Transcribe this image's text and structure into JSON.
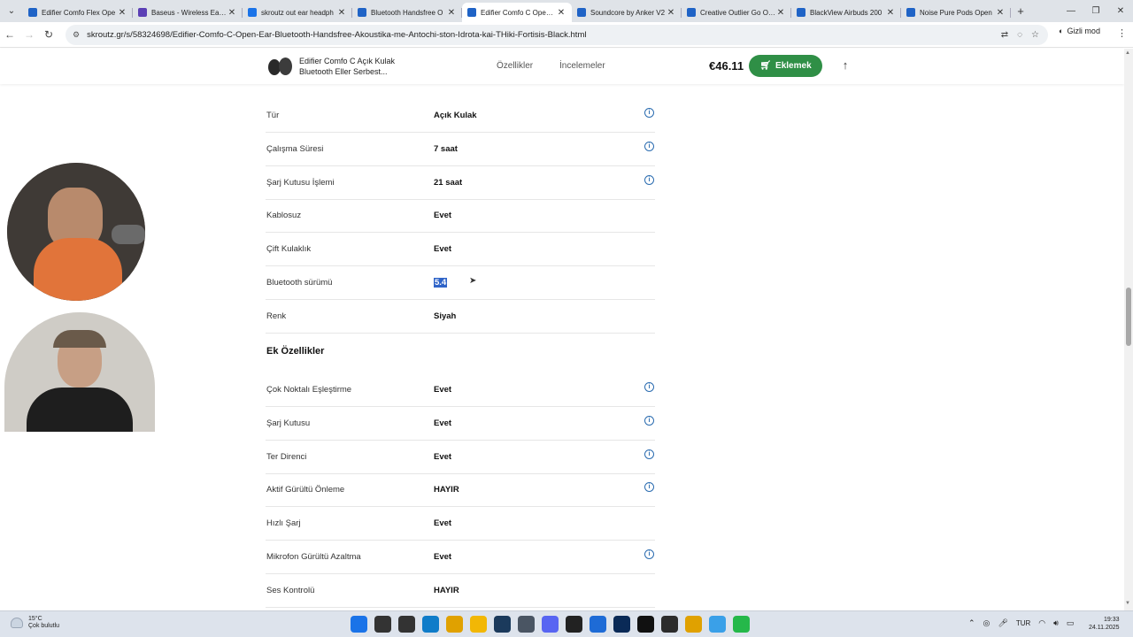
{
  "browser": {
    "tabs": [
      {
        "title": "Edifier Comfo Flex Ope",
        "color": "#1f63c6",
        "active": false
      },
      {
        "title": "Baseus - Wireless Earbu",
        "color": "#5b3fb5",
        "active": false
      },
      {
        "title": "skroutz out ear headph",
        "color": "#1a73e8",
        "active": false
      },
      {
        "title": "Bluetooth Handsfree O",
        "color": "#1f63c6",
        "active": false
      },
      {
        "title": "Edifier Comfo C Open E",
        "color": "#1f63c6",
        "active": true
      },
      {
        "title": "Soundcore by Anker V2",
        "color": "#1f63c6",
        "active": false
      },
      {
        "title": "Creative Outlier Go Ope",
        "color": "#1f63c6",
        "active": false
      },
      {
        "title": "BlackView Airbuds 200",
        "color": "#1f63c6",
        "active": false
      },
      {
        "title": "Noise Pure Pods Open",
        "color": "#1f63c6",
        "active": false
      }
    ],
    "url": "skroutz.gr/s/58324698/Edifier-Comfo-C-Open-Ear-Bluetooth-Handsfree-Akoustika-me-Antochi-ston-Idrota-kai-THiki-Fortisis-Black.html",
    "incognito_label": "Gizli mod"
  },
  "header": {
    "product_name": "Edifier Comfo C Açık Kulak Bluetooth Eller Serbest...",
    "nav_features": "Özellikler",
    "nav_reviews": "İncelemeler",
    "price": "€46.11",
    "add_button": "Eklemek"
  },
  "specs": [
    {
      "label": "Tür",
      "value": "Açık Kulak",
      "info": true
    },
    {
      "label": "Çalışma Süresi",
      "value": "7 saat",
      "info": true
    },
    {
      "label": "Şarj Kutusu İşlemi",
      "value": "21 saat",
      "info": true
    },
    {
      "label": "Kablosuz",
      "value": "Evet",
      "info": false
    },
    {
      "label": "Çift Kulaklık",
      "value": "Evet",
      "info": false
    },
    {
      "label": "Bluetooth sürümü",
      "value": "5.4",
      "info": false,
      "selected": true
    },
    {
      "label": "Renk",
      "value": "Siyah",
      "info": false
    }
  ],
  "extra_section_title": "Ek Özellikler",
  "extra_specs": [
    {
      "label": "Çok Noktalı Eşleştirme",
      "value": "Evet",
      "info": true
    },
    {
      "label": "Şarj Kutusu",
      "value": "Evet",
      "info": true
    },
    {
      "label": "Ter Direnci",
      "value": "Evet",
      "info": true
    },
    {
      "label": "Aktif Gürültü Önleme",
      "value": "HAYIR",
      "info": true
    },
    {
      "label": "Hızlı Şarj",
      "value": "Evet",
      "info": false
    },
    {
      "label": "Mikrofon Gürültü Azaltma",
      "value": "Evet",
      "info": true
    },
    {
      "label": "Ses Kontrolü",
      "value": "HAYIR",
      "info": false
    }
  ],
  "taskbar": {
    "temperature": "15°C",
    "weather": "Çok bulutlu",
    "language": "TUR",
    "time": "19:33",
    "date": "24.11.2025",
    "apps": [
      {
        "name": "windows-start-icon",
        "color": "#1a73e8"
      },
      {
        "name": "search-icon",
        "color": "#333333"
      },
      {
        "name": "task-view-icon",
        "color": "#333333"
      },
      {
        "name": "edge-icon",
        "color": "#0f7cc9"
      },
      {
        "name": "chrome-icon",
        "color": "#e0a100"
      },
      {
        "name": "file-explorer-icon",
        "color": "#f2b705"
      },
      {
        "name": "steam-icon",
        "color": "#1b3a5c"
      },
      {
        "name": "calculator-icon",
        "color": "#4a5563"
      },
      {
        "name": "discord-icon",
        "color": "#5865f2"
      },
      {
        "name": "media-app-icon",
        "color": "#222222"
      },
      {
        "name": "mail-icon",
        "color": "#1e6bd6"
      },
      {
        "name": "photoshop-icon",
        "color": "#0a2a57"
      },
      {
        "name": "capcut-icon",
        "color": "#111111"
      },
      {
        "name": "editor-app-icon",
        "color": "#2c2c2c"
      },
      {
        "name": "chrome-active-icon",
        "color": "#e0a100"
      },
      {
        "name": "notes-app-icon",
        "color": "#3aa0e8"
      },
      {
        "name": "whatsapp-icon",
        "color": "#25b84a"
      }
    ]
  }
}
